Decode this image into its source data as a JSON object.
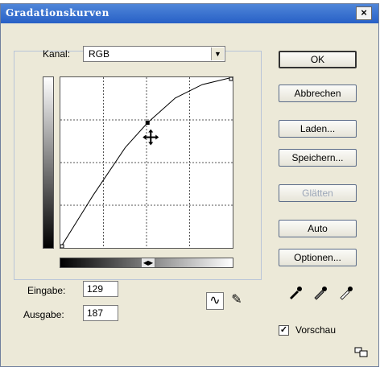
{
  "window": {
    "title": "Gradationskurven",
    "close_glyph": "×"
  },
  "channel": {
    "label": "Kanal:",
    "value": "RGB"
  },
  "fields": {
    "input_label": "Eingabe:",
    "input_value": "129",
    "output_label": "Ausgabe:",
    "output_value": "187"
  },
  "buttons": {
    "ok": "OK",
    "cancel": "Abbrechen",
    "load": "Laden...",
    "save": "Speichern...",
    "smooth": "Glätten",
    "auto": "Auto",
    "options": "Optionen..."
  },
  "preview": {
    "label": "Vorschau",
    "checked": true
  },
  "curve": {
    "selected_point": {
      "input": 129,
      "output": 187
    },
    "points": [
      [
        0,
        0
      ],
      [
        48,
        78
      ],
      [
        96,
        150
      ],
      [
        129,
        187
      ],
      [
        170,
        224
      ],
      [
        210,
        244
      ],
      [
        255,
        255
      ]
    ]
  },
  "icons": {
    "curve_tool": "curve-tool-icon",
    "pencil_tool": "pencil-tool-icon",
    "black_eyedropper": "eyedropper-black-icon",
    "gray_eyedropper": "eyedropper-gray-icon",
    "white_eyedropper": "eyedropper-white-icon"
  }
}
